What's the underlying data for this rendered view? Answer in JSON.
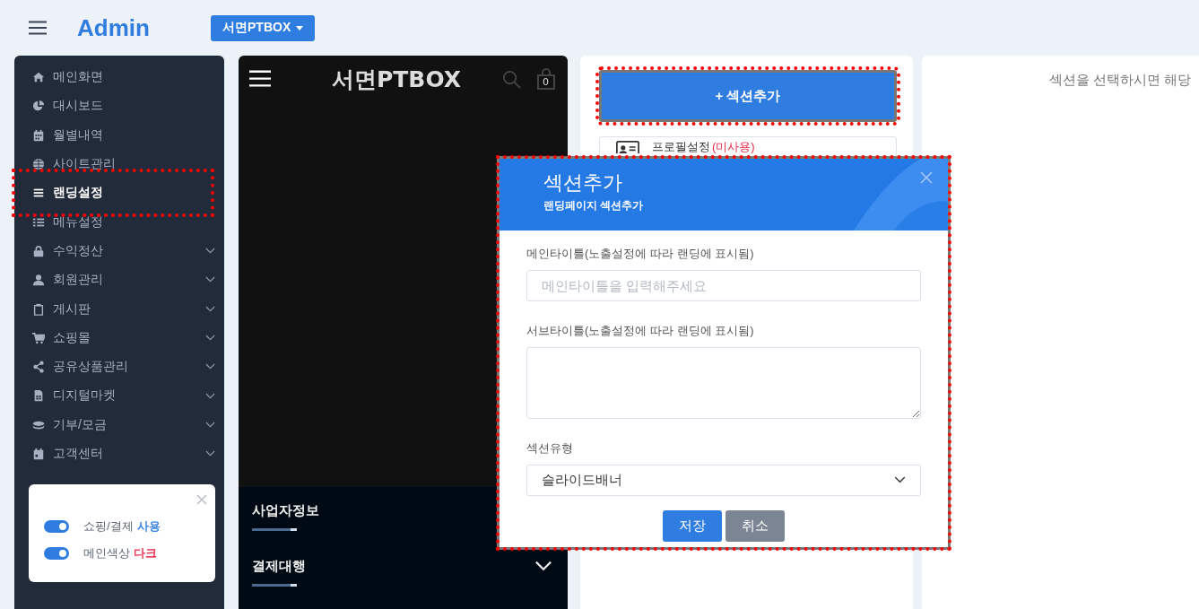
{
  "topbar": {
    "brand": "Admin",
    "site_dropdown": "서면PTBOX"
  },
  "sidebar": {
    "items": [
      {
        "label": "메인화면",
        "has_submenu": false,
        "selected": false,
        "highlighted": false
      },
      {
        "label": "대시보드",
        "has_submenu": false,
        "selected": false,
        "highlighted": false
      },
      {
        "label": "월별내역",
        "has_submenu": false,
        "selected": false,
        "highlighted": false
      },
      {
        "label": "사이트관리",
        "has_submenu": false,
        "selected": false,
        "highlighted": false
      },
      {
        "label": "랜딩설정",
        "has_submenu": false,
        "selected": true,
        "highlighted": true
      },
      {
        "label": "메뉴설정",
        "has_submenu": false,
        "selected": false,
        "highlighted": false
      },
      {
        "label": "수익정산",
        "has_submenu": true,
        "selected": false,
        "highlighted": false
      },
      {
        "label": "회원관리",
        "has_submenu": true,
        "selected": false,
        "highlighted": false
      },
      {
        "label": "게시판",
        "has_submenu": true,
        "selected": false,
        "highlighted": false
      },
      {
        "label": "쇼핑몰",
        "has_submenu": true,
        "selected": false,
        "highlighted": false
      },
      {
        "label": "공유상품관리",
        "has_submenu": true,
        "selected": false,
        "highlighted": false
      },
      {
        "label": "디지털마켓",
        "has_submenu": true,
        "selected": false,
        "highlighted": false
      },
      {
        "label": "기부/모금",
        "has_submenu": true,
        "selected": false,
        "highlighted": false
      },
      {
        "label": "고객센터",
        "has_submenu": true,
        "selected": false,
        "highlighted": false
      }
    ],
    "notice_card": {
      "toggles": [
        {
          "label": "쇼핑/결제",
          "value": "사용",
          "on": true,
          "color": "#2f7de1"
        },
        {
          "label": "메인색상",
          "value": "다크",
          "on": true,
          "color": "#e8264a"
        }
      ]
    }
  },
  "preview": {
    "title": "서면PTBOX",
    "cart_count": "0",
    "footer_sections": [
      {
        "title": "사업자정보",
        "expandable": false
      },
      {
        "title": "결제대행",
        "expandable": true
      }
    ]
  },
  "sections_panel": {
    "add_button": {
      "label": "+ 섹션추가",
      "highlighted": true
    },
    "sections": [
      {
        "label": "프로필설정",
        "note": "(미사용)"
      }
    ]
  },
  "detail_panel": {
    "message": "섹션을 선택하시면 해당"
  },
  "modal": {
    "title": "섹션추가",
    "subtitle": "랜딩페이지 섹션추가",
    "highlighted": true,
    "fields": [
      {
        "kind": "input",
        "label": "메인타이틀(노출설정에 따라 랜딩에 표시됨)",
        "placeholder": "메인타이틀을 입력해주세요"
      },
      {
        "kind": "textarea",
        "label": "서브타이틀(노출설정에 따라 랜딩에 표시됨)"
      },
      {
        "kind": "select",
        "label": "섹션유형",
        "value": "슬라이드배너"
      }
    ],
    "buttons": [
      {
        "label": "저장",
        "kind": "primary"
      },
      {
        "label": "취소",
        "kind": "secondary"
      }
    ]
  }
}
